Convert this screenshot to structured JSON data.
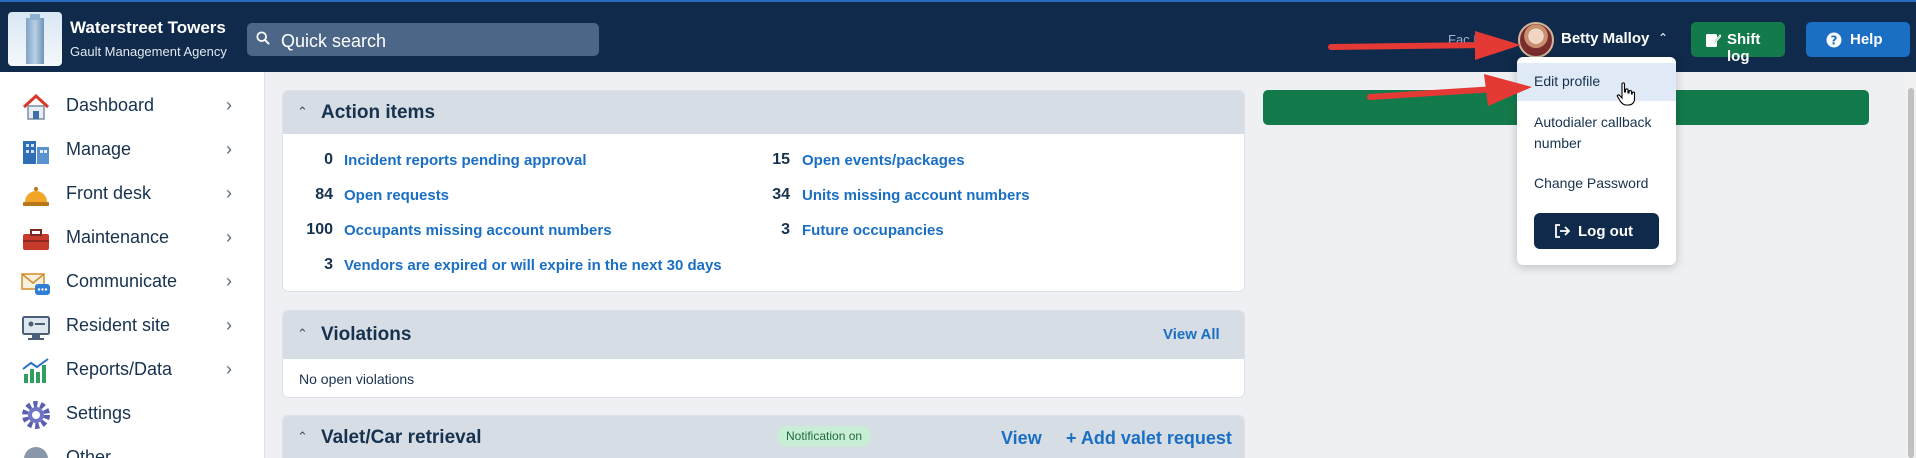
{
  "header": {
    "brand_name": "Waterstreet Towers",
    "brand_sub": "Gault Management Agency",
    "search_label": "Quick search",
    "fac_id_label": "Fac ID:",
    "user_name": "Betty Malloy",
    "shift_log_label": "Shift log",
    "help_label": "Help"
  },
  "sidebar": {
    "items": [
      {
        "label": "Dashboard",
        "icon": "house-icon"
      },
      {
        "label": "Manage",
        "icon": "buildings-icon"
      },
      {
        "label": "Front desk",
        "icon": "service-bell-icon"
      },
      {
        "label": "Maintenance",
        "icon": "toolbox-icon"
      },
      {
        "label": "Communicate",
        "icon": "envelope-chat-icon"
      },
      {
        "label": "Resident site",
        "icon": "monitor-icon"
      },
      {
        "label": "Reports/Data",
        "icon": "bar-chart-icon"
      },
      {
        "label": "Settings",
        "icon": "gear-icon"
      },
      {
        "label": "Other",
        "icon": "other-icon"
      }
    ]
  },
  "action_items": {
    "title": "Action items",
    "left": [
      {
        "count": "0",
        "label": "Incident reports pending approval"
      },
      {
        "count": "84",
        "label": "Open requests"
      },
      {
        "count": "100",
        "label": "Occupants missing account numbers"
      },
      {
        "count": "3",
        "label": "Vendors are expired or will expire in the next 30 days"
      }
    ],
    "right": [
      {
        "count": "15",
        "label": "Open events/packages"
      },
      {
        "count": "34",
        "label": "Units missing account numbers"
      },
      {
        "count": "3",
        "label": "Future occupancies"
      }
    ]
  },
  "violations": {
    "title": "Violations",
    "view_all": "View All",
    "empty": "No open violations"
  },
  "valet": {
    "title": "Valet/Car retrieval",
    "badge": "Notification on",
    "view": "View",
    "add": "+ Add valet request"
  },
  "user_menu": {
    "items": [
      "Edit profile",
      "Autodialer callback number",
      "Change Password"
    ],
    "logout": "Log out"
  },
  "colors": {
    "topbar": "#0f2a4a",
    "accent_blue": "#1a6fc4",
    "accent_green": "#137a4b",
    "annotation_red": "#e53935"
  }
}
